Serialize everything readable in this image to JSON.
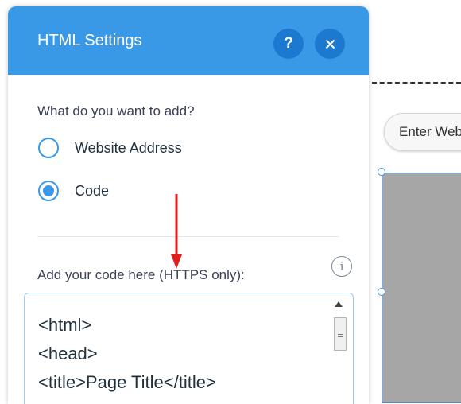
{
  "panel": {
    "title": "HTML Settings",
    "help_label": "?",
    "question": "What do you want to add?",
    "options": [
      {
        "label": "Website Address",
        "selected": false
      },
      {
        "label": "Code",
        "selected": true
      }
    ],
    "code_label": "Add your code here (HTTPS only):",
    "info_label": "i",
    "code_lines": "<html>\n<head>\n<title>Page Title</title>"
  },
  "canvas": {
    "enter_button_label": "Enter Website"
  },
  "colors": {
    "header": "#3a99e7",
    "header_button": "#1c79cf",
    "arrow": "#e01e1e"
  }
}
